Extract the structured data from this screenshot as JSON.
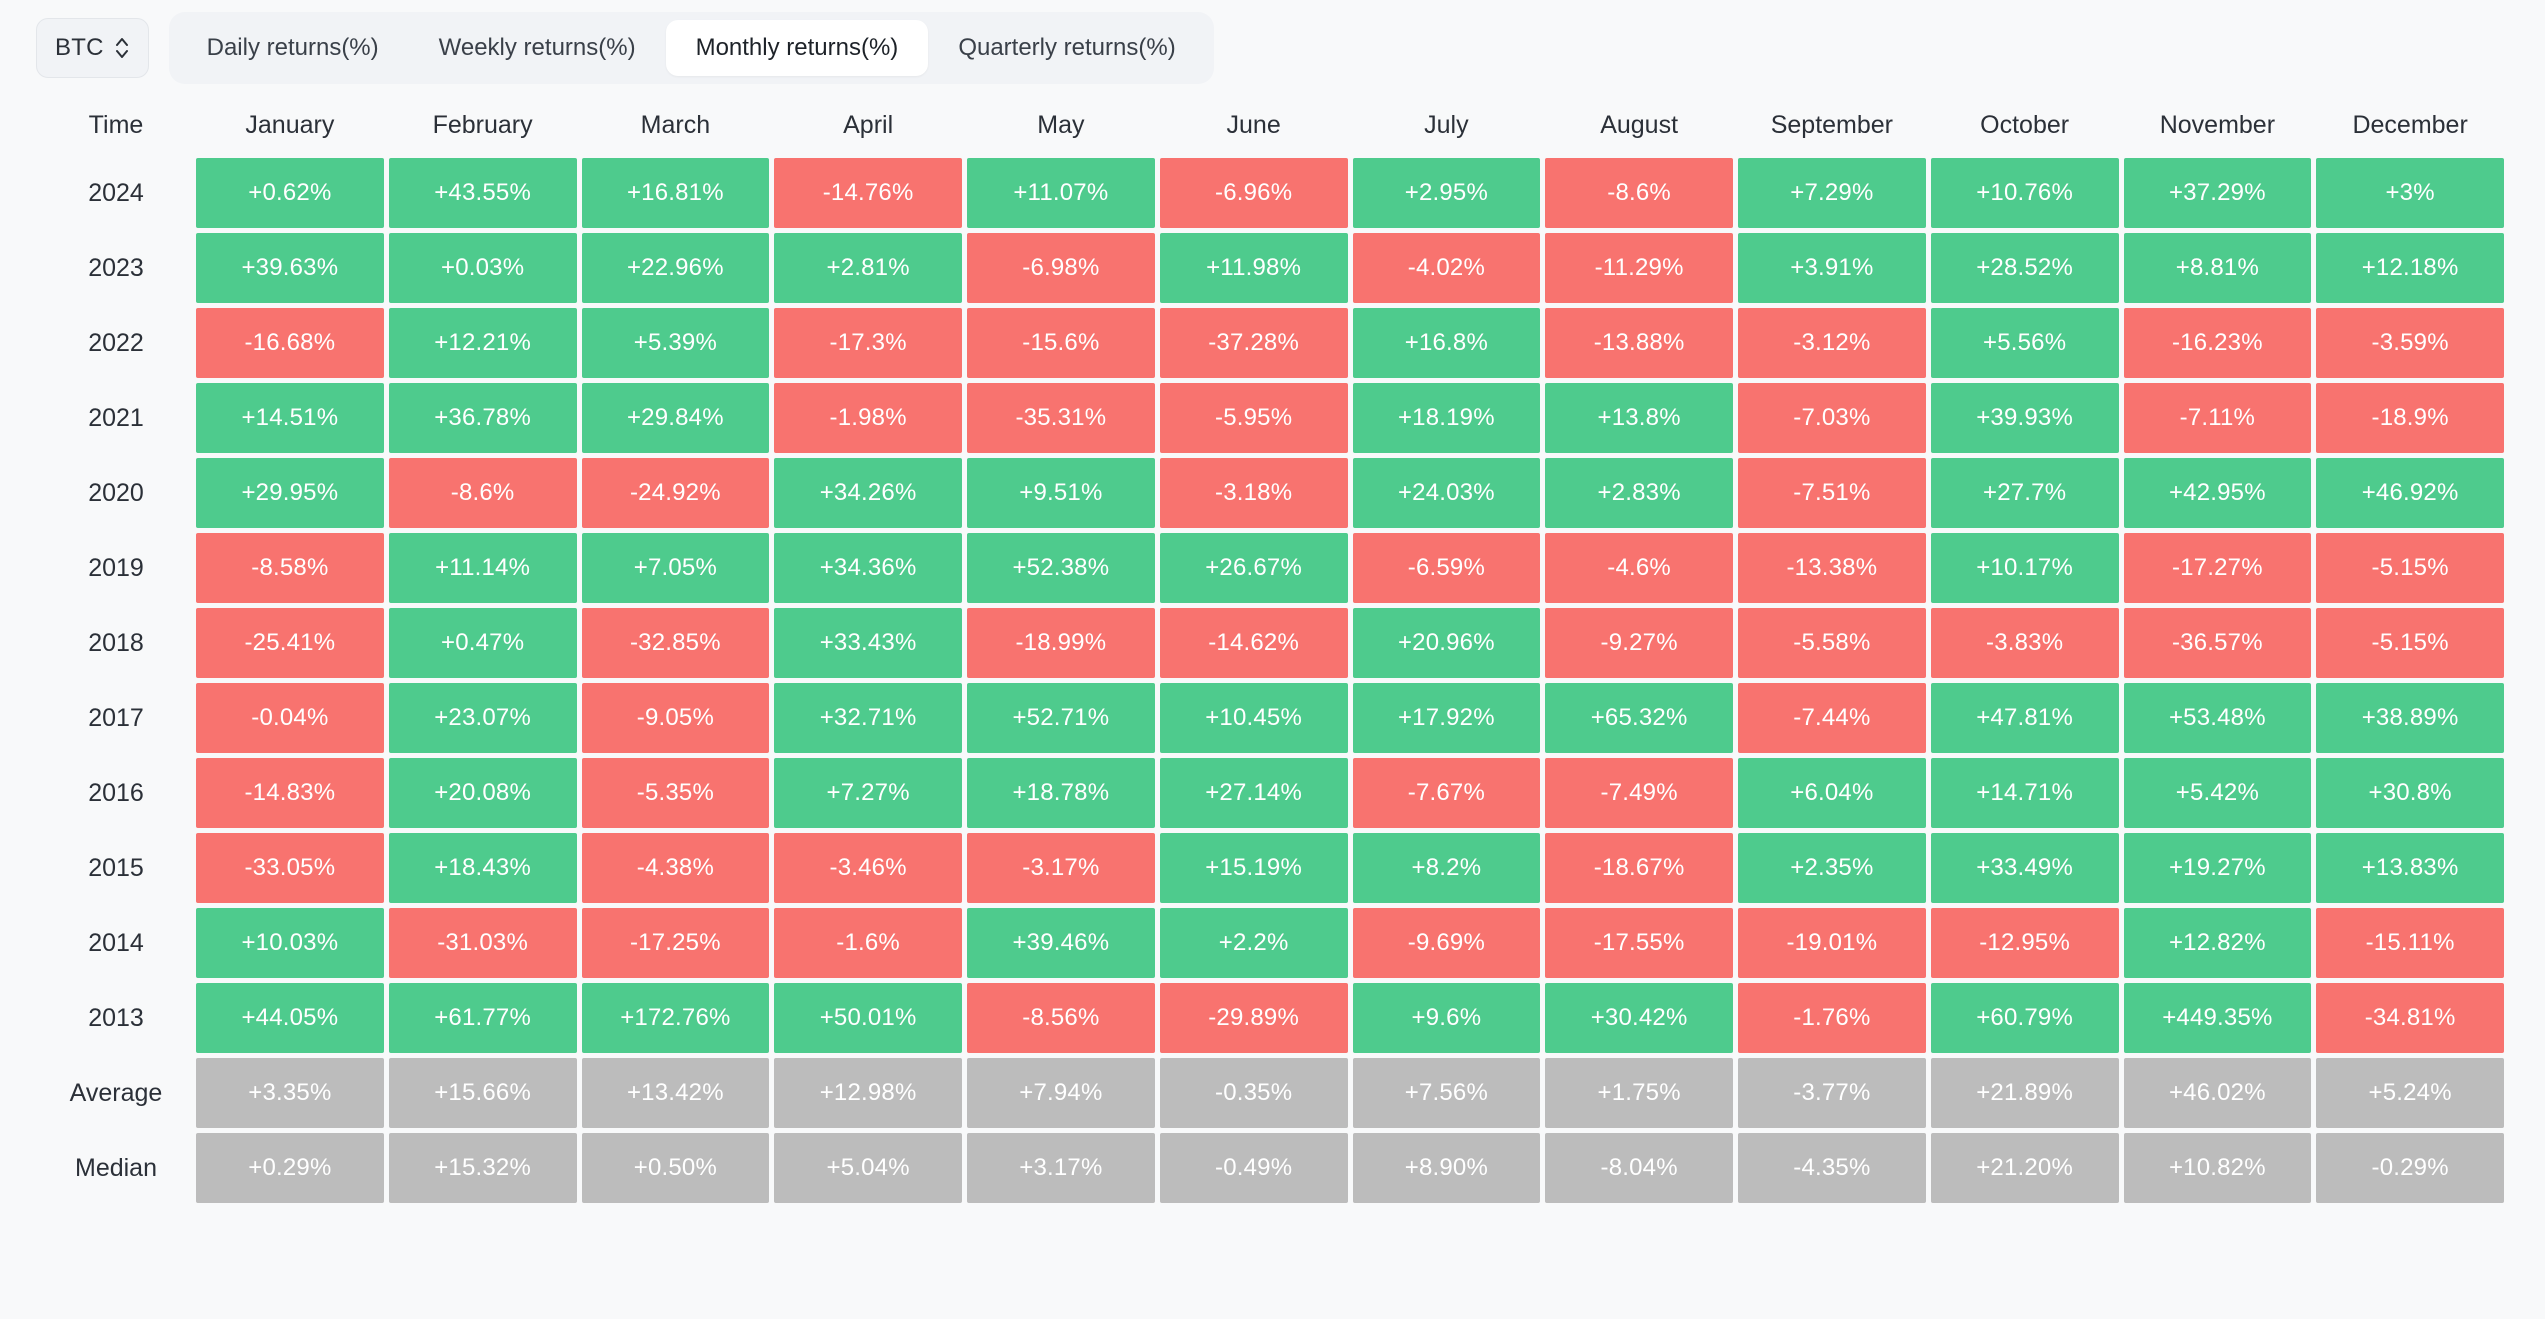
{
  "toolbar": {
    "symbol": "BTC",
    "symbol_icon": "chevron-up-down-icon",
    "tabs": [
      {
        "label": "Daily returns(%)",
        "active": false
      },
      {
        "label": "Weekly returns(%)",
        "active": false
      },
      {
        "label": "Monthly returns(%)",
        "active": true
      },
      {
        "label": "Quarterly returns(%)",
        "active": false
      }
    ]
  },
  "colors": {
    "positive": "#4ecb8d",
    "negative": "#f8736f",
    "stat": "#bcbcbc",
    "background": "#f8f9fa",
    "tab_active_bg": "#ffffff",
    "tab_group_bg": "#f1f3f6"
  },
  "chart_data": {
    "type": "heatmap",
    "title": "Monthly returns(%)",
    "xlabel": "",
    "ylabel": "Time",
    "legend": "",
    "grid": false,
    "time_header": "Time",
    "categories": [
      "January",
      "February",
      "March",
      "April",
      "May",
      "June",
      "July",
      "August",
      "September",
      "October",
      "November",
      "December"
    ],
    "rows": [
      {
        "label": "2024",
        "kind": "year",
        "values": [
          "+0.62%",
          "+43.55%",
          "+16.81%",
          "-14.76%",
          "+11.07%",
          "-6.96%",
          "+2.95%",
          "-8.6%",
          "+7.29%",
          "+10.76%",
          "+37.29%",
          "+3%"
        ]
      },
      {
        "label": "2023",
        "kind": "year",
        "values": [
          "+39.63%",
          "+0.03%",
          "+22.96%",
          "+2.81%",
          "-6.98%",
          "+11.98%",
          "-4.02%",
          "-11.29%",
          "+3.91%",
          "+28.52%",
          "+8.81%",
          "+12.18%"
        ]
      },
      {
        "label": "2022",
        "kind": "year",
        "values": [
          "-16.68%",
          "+12.21%",
          "+5.39%",
          "-17.3%",
          "-15.6%",
          "-37.28%",
          "+16.8%",
          "-13.88%",
          "-3.12%",
          "+5.56%",
          "-16.23%",
          "-3.59%"
        ]
      },
      {
        "label": "2021",
        "kind": "year",
        "values": [
          "+14.51%",
          "+36.78%",
          "+29.84%",
          "-1.98%",
          "-35.31%",
          "-5.95%",
          "+18.19%",
          "+13.8%",
          "-7.03%",
          "+39.93%",
          "-7.11%",
          "-18.9%"
        ]
      },
      {
        "label": "2020",
        "kind": "year",
        "values": [
          "+29.95%",
          "-8.6%",
          "-24.92%",
          "+34.26%",
          "+9.51%",
          "-3.18%",
          "+24.03%",
          "+2.83%",
          "-7.51%",
          "+27.7%",
          "+42.95%",
          "+46.92%"
        ]
      },
      {
        "label": "2019",
        "kind": "year",
        "values": [
          "-8.58%",
          "+11.14%",
          "+7.05%",
          "+34.36%",
          "+52.38%",
          "+26.67%",
          "-6.59%",
          "-4.6%",
          "-13.38%",
          "+10.17%",
          "-17.27%",
          "-5.15%"
        ]
      },
      {
        "label": "2018",
        "kind": "year",
        "values": [
          "-25.41%",
          "+0.47%",
          "-32.85%",
          "+33.43%",
          "-18.99%",
          "-14.62%",
          "+20.96%",
          "-9.27%",
          "-5.58%",
          "-3.83%",
          "-36.57%",
          "-5.15%"
        ]
      },
      {
        "label": "2017",
        "kind": "year",
        "values": [
          "-0.04%",
          "+23.07%",
          "-9.05%",
          "+32.71%",
          "+52.71%",
          "+10.45%",
          "+17.92%",
          "+65.32%",
          "-7.44%",
          "+47.81%",
          "+53.48%",
          "+38.89%"
        ]
      },
      {
        "label": "2016",
        "kind": "year",
        "values": [
          "-14.83%",
          "+20.08%",
          "-5.35%",
          "+7.27%",
          "+18.78%",
          "+27.14%",
          "-7.67%",
          "-7.49%",
          "+6.04%",
          "+14.71%",
          "+5.42%",
          "+30.8%"
        ]
      },
      {
        "label": "2015",
        "kind": "year",
        "values": [
          "-33.05%",
          "+18.43%",
          "-4.38%",
          "-3.46%",
          "-3.17%",
          "+15.19%",
          "+8.2%",
          "-18.67%",
          "+2.35%",
          "+33.49%",
          "+19.27%",
          "+13.83%"
        ]
      },
      {
        "label": "2014",
        "kind": "year",
        "values": [
          "+10.03%",
          "-31.03%",
          "-17.25%",
          "-1.6%",
          "+39.46%",
          "+2.2%",
          "-9.69%",
          "-17.55%",
          "-19.01%",
          "-12.95%",
          "+12.82%",
          "-15.11%"
        ]
      },
      {
        "label": "2013",
        "kind": "year",
        "values": [
          "+44.05%",
          "+61.77%",
          "+172.76%",
          "+50.01%",
          "-8.56%",
          "-29.89%",
          "+9.6%",
          "+30.42%",
          "-1.76%",
          "+60.79%",
          "+449.35%",
          "-34.81%"
        ]
      },
      {
        "label": "Average",
        "kind": "stat",
        "values": [
          "+3.35%",
          "+15.66%",
          "+13.42%",
          "+12.98%",
          "+7.94%",
          "-0.35%",
          "+7.56%",
          "+1.75%",
          "-3.77%",
          "+21.89%",
          "+46.02%",
          "+5.24%"
        ]
      },
      {
        "label": "Median",
        "kind": "stat",
        "values": [
          "+0.29%",
          "+15.32%",
          "+0.50%",
          "+5.04%",
          "+3.17%",
          "-0.49%",
          "+8.90%",
          "-8.04%",
          "-4.35%",
          "+21.20%",
          "+10.82%",
          "-0.29%"
        ]
      }
    ]
  }
}
